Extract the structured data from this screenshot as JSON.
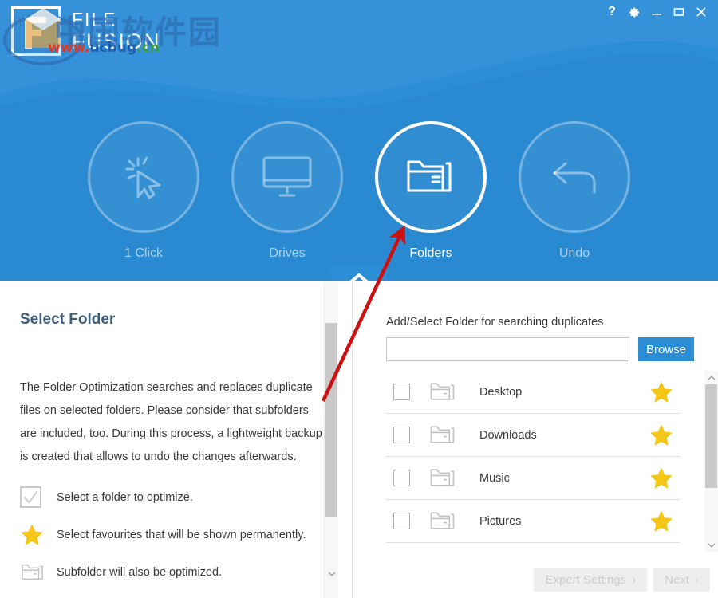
{
  "window": {
    "controls": [
      {
        "name": "help-button",
        "glyph": "?"
      },
      {
        "name": "settings-button",
        "glyph": "gear-icon"
      },
      {
        "name": "minimize-button",
        "glyph": "minimize-icon"
      },
      {
        "name": "maximize-button",
        "glyph": "maximize-icon"
      },
      {
        "name": "close-button",
        "glyph": "close-icon"
      }
    ]
  },
  "brand": {
    "line1": "FILE",
    "line2": "FUSION"
  },
  "watermark": {
    "site_cn": "中国软件园",
    "url_www": "www.",
    "url_mid": "ucbug",
    "url_tld": ".cn"
  },
  "nav": {
    "items": [
      {
        "label": "1 Click",
        "icon": "cursor-click-icon",
        "active": false
      },
      {
        "label": "Drives",
        "icon": "monitor-icon",
        "active": false
      },
      {
        "label": "Folders",
        "icon": "folders-icon",
        "active": true
      },
      {
        "label": "Undo",
        "icon": "undo-arrow-icon",
        "active": false
      }
    ],
    "collapse_icon": "chevron-up-icon"
  },
  "left": {
    "title": "Select Folder",
    "description": "The Folder Optimization searches and replaces duplicate files on selected folders. Please consider that subfolders are included, too. During this process, a lightweight backup is created that allows to undo the changes afterwards.",
    "legend": [
      {
        "icon": "checkbox-checked-icon",
        "text": "Select a folder to optimize."
      },
      {
        "icon": "star-icon",
        "text": "Select favourites that will be shown permanently."
      },
      {
        "icon": "folders-small-icon",
        "text": "Subfolder will also be optimized."
      }
    ]
  },
  "right": {
    "label": "Add/Select Folder for searching duplicates",
    "input_value": "",
    "input_placeholder": "",
    "browse_label": "Browse",
    "folders": [
      {
        "name": "Desktop",
        "checked": false,
        "favourite": true
      },
      {
        "name": "Downloads",
        "checked": false,
        "favourite": true
      },
      {
        "name": "Music",
        "checked": false,
        "favourite": true
      },
      {
        "name": "Pictures",
        "checked": false,
        "favourite": true
      },
      {
        "name": "",
        "checked": false,
        "favourite": true
      }
    ]
  },
  "footer": {
    "expert_settings_label": "Expert Settings",
    "expert_settings_chevron": "›",
    "next_label": "Next",
    "next_chevron": "›"
  },
  "colors": {
    "header_blue": "#2b8dd6",
    "accent_blue": "#2b8dd6",
    "title_slate": "#3e5d7a",
    "star_yellow": "#f5c518",
    "annotation_red": "#cc1111",
    "disabled_btn_bg": "#eeeeee",
    "disabled_btn_text": "#cccccc"
  }
}
